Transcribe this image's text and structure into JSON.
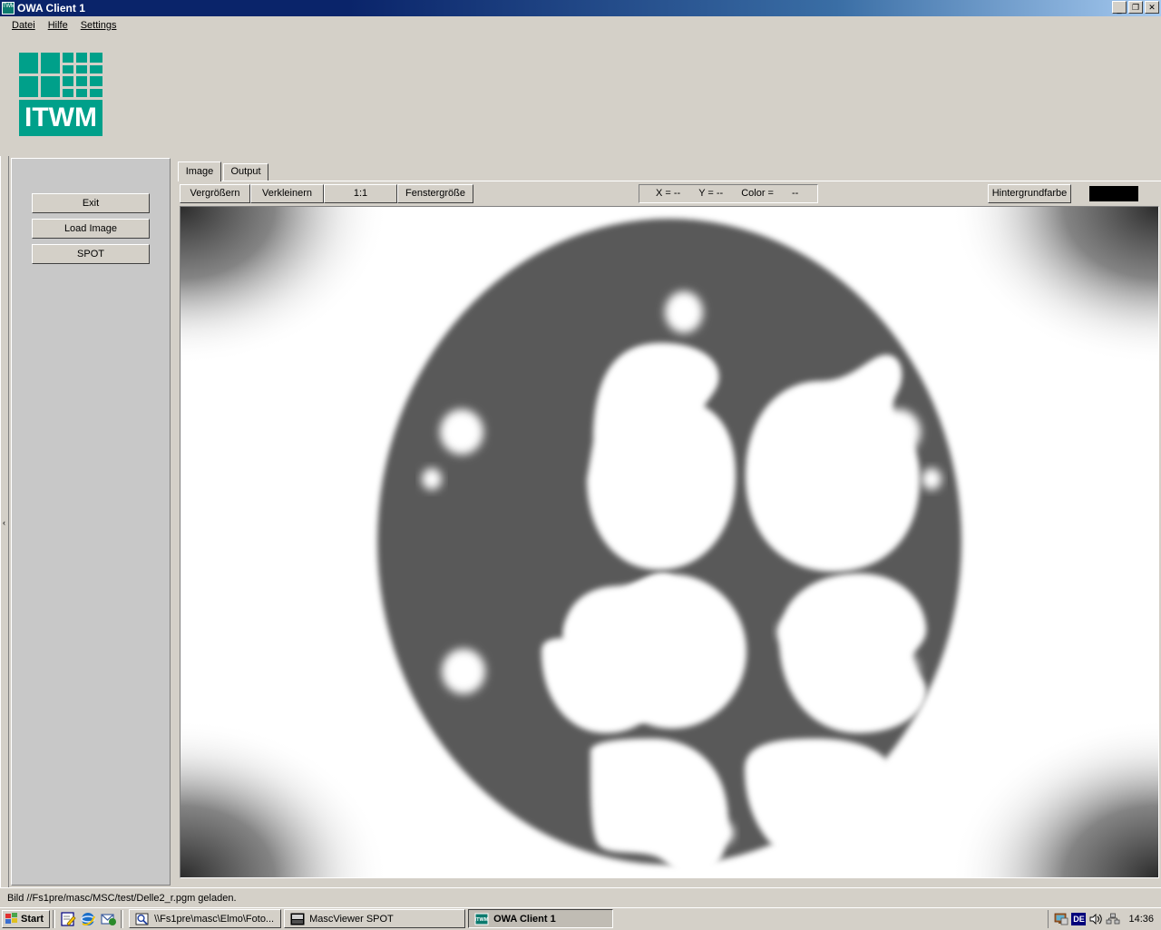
{
  "window": {
    "title": "OWA Client 1",
    "icon": "app-icon",
    "buttons": {
      "minimize": "_",
      "restore": "❐",
      "close": "✕"
    }
  },
  "menu": {
    "items": [
      {
        "label": "Datei",
        "accel": "D"
      },
      {
        "label": "Hilfe",
        "accel": "H"
      },
      {
        "label": "Settings",
        "accel": "S"
      }
    ]
  },
  "logo": {
    "text": "ITWM",
    "color": "#00a08a"
  },
  "sidebar": {
    "buttons": [
      {
        "label": "Exit"
      },
      {
        "label": "Load Image"
      },
      {
        "label": "SPOT"
      }
    ],
    "collapse_arrow": "‹"
  },
  "tabs": [
    {
      "label": "Image",
      "selected": true
    },
    {
      "label": "Output",
      "selected": false
    }
  ],
  "toolbar": {
    "buttons": [
      {
        "label": "Vergrößern"
      },
      {
        "label": "Verkleinern"
      },
      {
        "label": "1:1"
      },
      {
        "label": "Fenstergröße"
      }
    ],
    "coords": {
      "x_label": "X = --",
      "y_label": "Y = --",
      "color_label": "Color =",
      "color_value": "--"
    },
    "background_color_button": "Hintergrundfarbe",
    "background_color_value": "#000000"
  },
  "status": {
    "message": "Bild //Fs1pre/masc/MSC/test/Delle2_r.pgm geladen."
  },
  "taskbar": {
    "start_label": "Start",
    "quick_launch": [
      {
        "name": "show-desktop-icon"
      },
      {
        "name": "internet-explorer-icon"
      },
      {
        "name": "outlook-express-icon"
      }
    ],
    "tasks": [
      {
        "label": "\\\\Fs1pre\\masc\\Elmo\\Foto...",
        "icon": "explorer-icon",
        "active": false
      },
      {
        "label": "MascViewer SPOT",
        "icon": "mascviewer-icon",
        "active": false
      },
      {
        "label": "OWA Client 1",
        "icon": "owa-icon",
        "active": true
      }
    ],
    "tray": {
      "icons": [
        "display-icon",
        "volume-icon",
        "network-icon"
      ],
      "language": "DE",
      "time": "14:36"
    }
  },
  "image": {
    "description": "Grayscale radiographic scan of a cylinder head gasket",
    "gasket_gray": "#595959",
    "background": "#ffffff",
    "vignette_color": "#2b2b2b"
  }
}
